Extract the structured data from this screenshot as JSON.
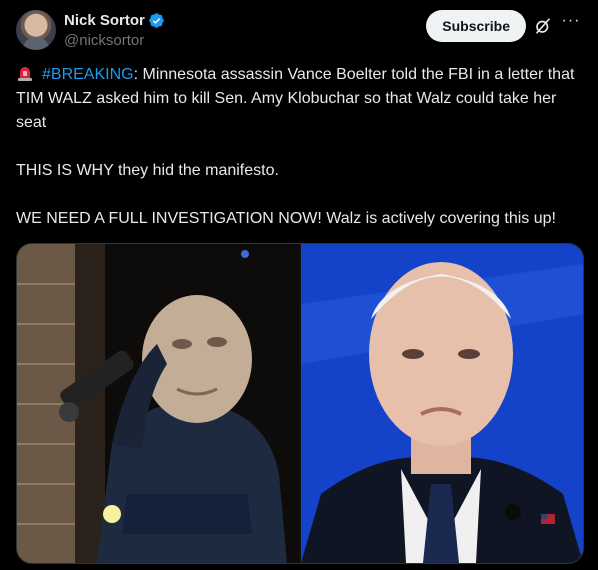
{
  "author": {
    "display_name": "Nick Sortor",
    "handle": "@nicksortor",
    "verified": true
  },
  "actions": {
    "subscribe_label": "Subscribe",
    "grok_icon": "grok-icon",
    "more_icon": "more-icon"
  },
  "post": {
    "emoji": "rotating-light-icon",
    "hashtag": "#BREAKING",
    "line1_rest": ": Minnesota assassin Vance Boelter told the FBI in a letter that TIM WALZ asked him to kill Sen. Amy Klobuchar so that Walz could take her seat",
    "paragraph2": "THIS IS WHY they hid the manifesto.",
    "paragraph3": "WE NEED A FULL INVESTIGATION NOW! Walz is actively covering this up!"
  },
  "colors": {
    "background": "#000000",
    "text": "#e7e9ea",
    "secondary": "#71767b",
    "link": "#1d9bf0",
    "verified_badge": "#1d9bf0"
  },
  "media": {
    "left_image": "masked-man-with-flashlight",
    "right_image": "man-in-suit-blue-background"
  }
}
